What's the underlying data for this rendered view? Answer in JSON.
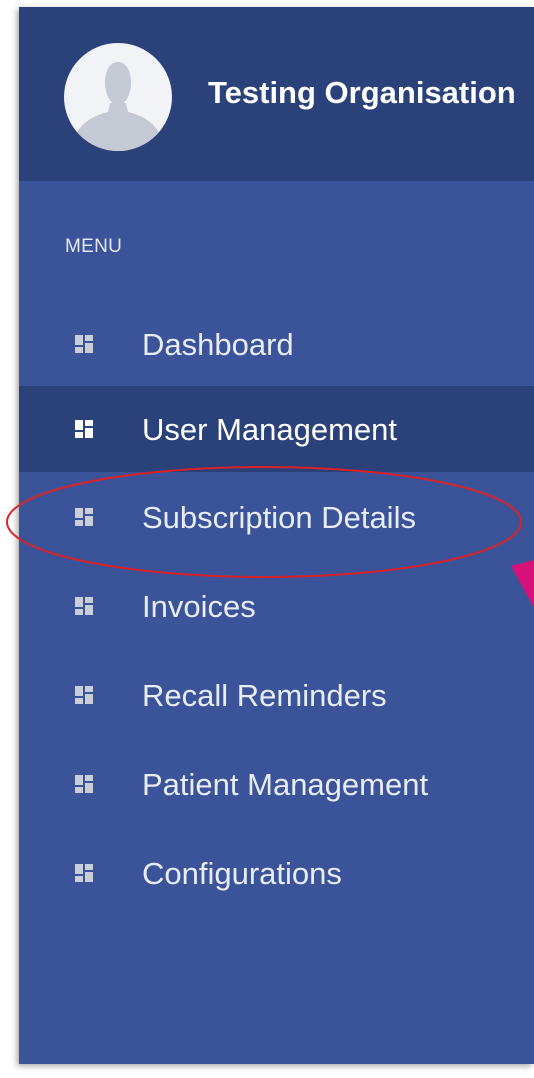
{
  "header": {
    "org_name": "Testing Organisation",
    "avatar_icon": "user-silhouette-icon"
  },
  "menu": {
    "section_label": "MENU",
    "icon_name": "dashboard-grid-icon",
    "active_index": 1,
    "items": [
      {
        "label": "Dashboard",
        "icon": "dashboard-grid-icon"
      },
      {
        "label": "User Management",
        "icon": "dashboard-grid-icon"
      },
      {
        "label": "Subscription Details",
        "icon": "dashboard-grid-icon"
      },
      {
        "label": "Invoices",
        "icon": "dashboard-grid-icon"
      },
      {
        "label": "Recall Reminders",
        "icon": "dashboard-grid-icon"
      },
      {
        "label": "Patient Management",
        "icon": "dashboard-grid-icon"
      },
      {
        "label": "Configurations",
        "icon": "dashboard-grid-icon"
      }
    ]
  },
  "annotation": {
    "highlighted_item": "Subscription Details",
    "ellipse_color": "#d8232a",
    "arrow_color": "#d6127a"
  },
  "colors": {
    "sidebar_bg": "#3b5499",
    "header_bg": "#2b4179",
    "active_item_bg": "#2b4179",
    "text": "#e8ecf5",
    "active_text": "#ffffff",
    "icon": "#c9ced9",
    "active_icon": "#ffffff"
  }
}
